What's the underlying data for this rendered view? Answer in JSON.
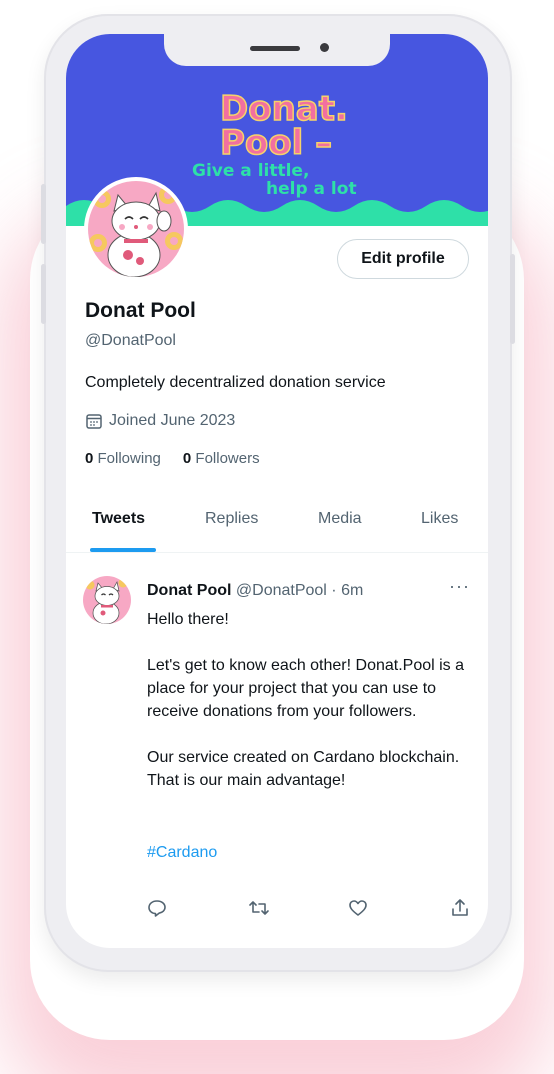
{
  "banner": {
    "title_line1": "Donat.",
    "title_line2": "Pool –",
    "tagline_line1": "Give a little,",
    "tagline_line2": "help a lot"
  },
  "profile": {
    "edit_label": "Edit profile",
    "name": "Donat Pool",
    "handle": "@DonatPool",
    "bio": "Completely decentralized donation service",
    "joined": "Joined June 2023",
    "following_count": "0",
    "following_label": "Following",
    "followers_count": "0",
    "followers_label": "Followers"
  },
  "tabs": [
    {
      "label": "Tweets",
      "active": true
    },
    {
      "label": "Replies",
      "active": false
    },
    {
      "label": "Media",
      "active": false
    },
    {
      "label": "Likes",
      "active": false
    }
  ],
  "tweet": {
    "author": "Donat Pool",
    "meta": "@DonatPool · 6m",
    "more": "···",
    "paragraphs": [
      "Hello there!",
      "Let's get to know each other! Donat.Pool is a place for your project that you can use to receive donations from your followers.",
      "Our service created on Cardano blockchain. That is our main advantage!"
    ],
    "hashtag": "#Cardano",
    "actions": [
      "reply-icon",
      "retweet-icon",
      "like-icon",
      "share-icon"
    ]
  },
  "colors": {
    "banner_bg": "#4756e0",
    "wave": "#2ee0a8",
    "accent": "#1d9bf0",
    "logo_pink": "#f26fa0"
  }
}
